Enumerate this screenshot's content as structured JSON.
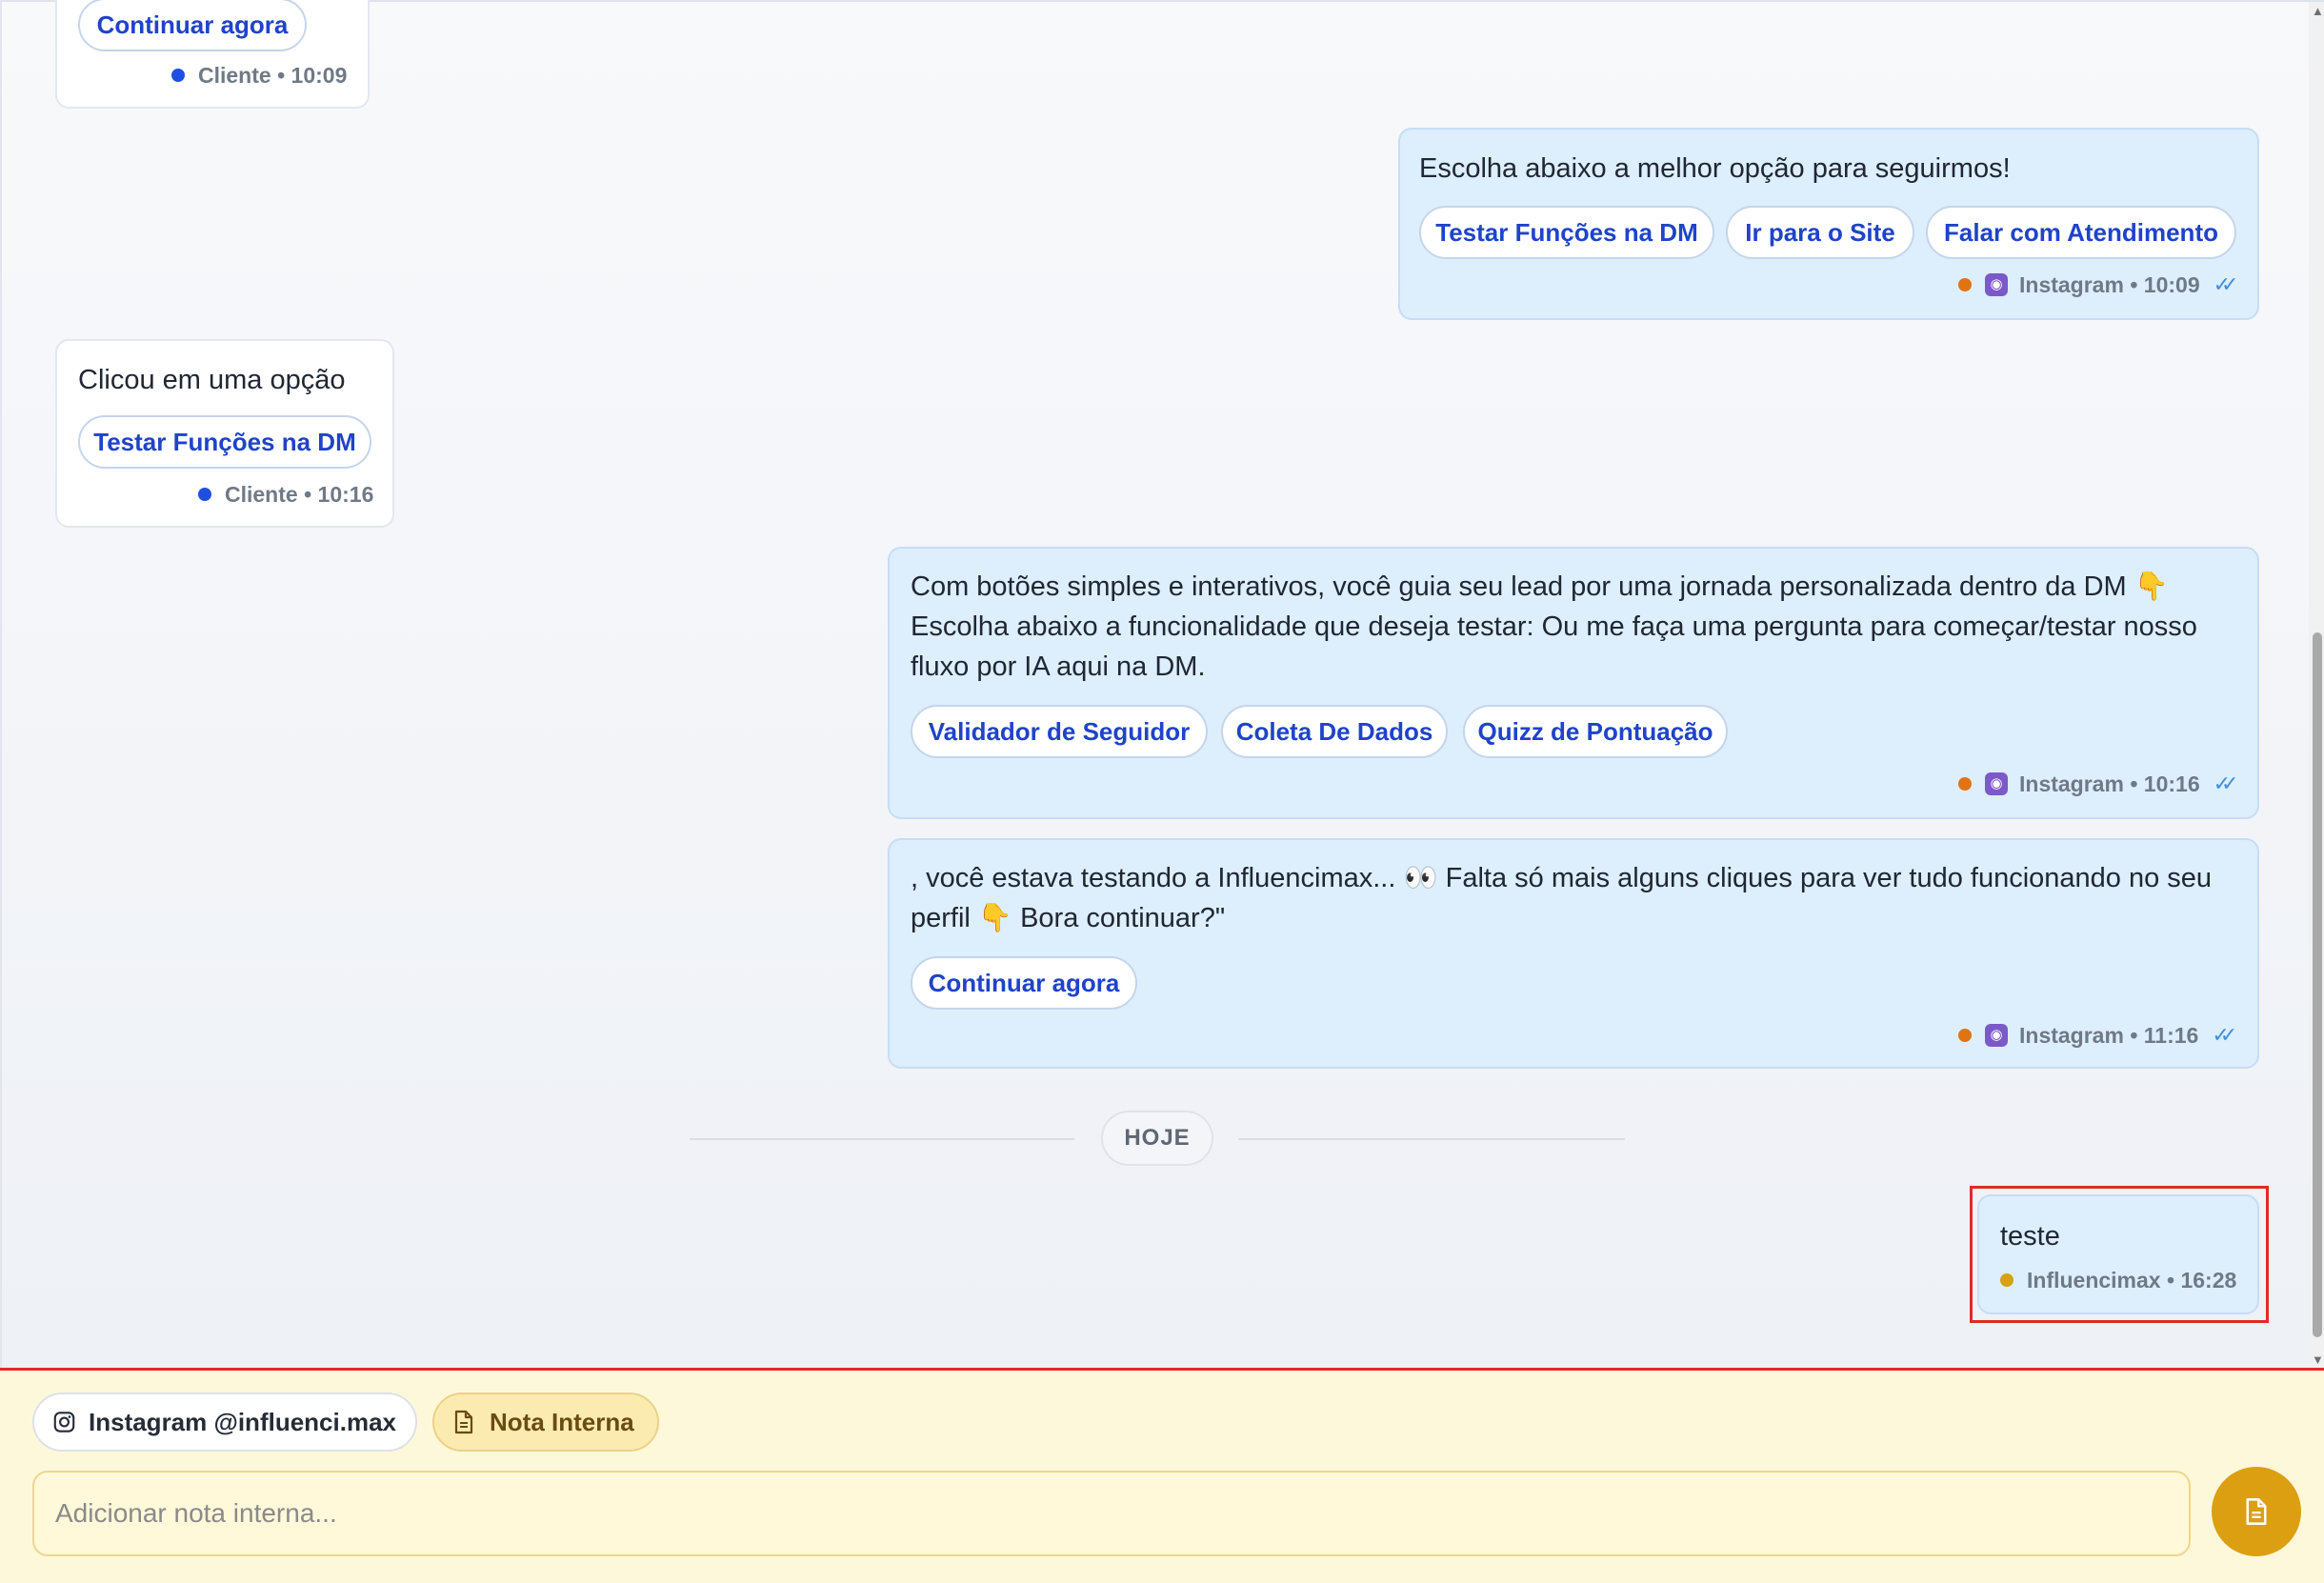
{
  "messages": [
    {
      "text": "",
      "buttons": [
        "Continuar agora"
      ],
      "meta": {
        "source": "Cliente",
        "time": "10:09",
        "dot_color": "#1f4fe0"
      }
    },
    {
      "text": "Escolha abaixo a melhor opção para seguirmos!",
      "buttons": [
        "Testar Funções na DM",
        "Ir para o Site",
        "Falar com Atendimento"
      ],
      "meta": {
        "source": "Instagram",
        "time": "10:09",
        "dot_color": "#e07414",
        "read_icon": "double-check-icon"
      }
    },
    {
      "text": "Clicou em uma opção",
      "buttons": [
        "Testar Funções na DM"
      ],
      "meta": {
        "source": "Cliente",
        "time": "10:16",
        "dot_color": "#1f4fe0"
      }
    },
    {
      "text_lines": [
        "Com botões simples e interativos, você guia seu lead por uma jornada personalizada dentro da DM 👇",
        "Escolha abaixo a funcionalidade que deseja testar: Ou me faça uma pergunta para começar/testar nosso",
        "fluxo por IA aqui na DM."
      ],
      "buttons": [
        "Validador de Seguidor",
        "Coleta De Dados",
        "Quizz de Pontuação"
      ],
      "meta": {
        "source": "Instagram",
        "time": "10:16",
        "dot_color": "#e07414",
        "read_icon": "double-check-icon"
      }
    },
    {
      "text_lines": [
        ", você estava testando a Influencimax... 👀  Falta só mais alguns cliques para ver tudo funcionando no seu",
        "perfil 👇  Bora continuar?\""
      ],
      "buttons": [
        "Continuar agora"
      ],
      "meta": {
        "source": "Instagram",
        "time": "11:16",
        "dot_color": "#e07414",
        "read_icon": "double-check-icon"
      }
    },
    {
      "text": "teste",
      "meta": {
        "source": "Influencimax",
        "time": "16:28",
        "dot_color": "#d6a115"
      }
    }
  ],
  "date_divider": "HOJE",
  "composer": {
    "channel_chip": "Instagram @influenci.max",
    "note_chip": "Nota Interna",
    "placeholder": "Adicionar nota interna...",
    "channel_icon": "instagram-icon",
    "note_icon": "document-icon",
    "send_icon": "document-icon"
  },
  "colors": {
    "accent_blue": "#1f43c9",
    "outgoing_bubble": "#ddeefd",
    "note_bg": "#fef8db",
    "send_button": "#dc9f12",
    "highlight": "#e02a2a"
  }
}
